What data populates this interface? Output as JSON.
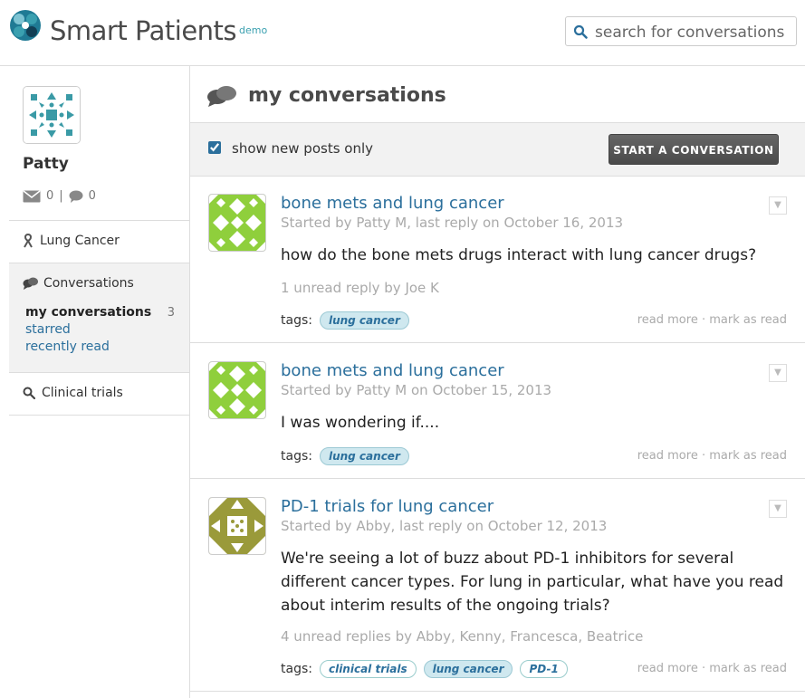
{
  "header": {
    "app_name": "Smart Patients",
    "badge": "demo",
    "search_placeholder": "search for conversations"
  },
  "sidebar": {
    "username": "Patty",
    "message_count": "0",
    "separator": "|",
    "comment_count": "0",
    "condition": "Lung Cancer",
    "conversations_label": "Conversations",
    "links": [
      {
        "label": "my conversations",
        "count": "3"
      },
      {
        "label": "starred"
      },
      {
        "label": "recently read"
      }
    ],
    "clinical_trials": "Clinical trials"
  },
  "main": {
    "title": "my conversations",
    "show_new_label": "show new posts only",
    "show_new_checked": true,
    "start_button": "START A CONVERSATION",
    "posts": [
      {
        "title": "bone mets and lung cancer",
        "meta": "Started by Patty M, last reply on October 16, 2013",
        "body": "how do the bone mets drugs interact with lung cancer drugs?",
        "replies": "1 unread reply by Joe K",
        "tags_label": "tags:",
        "tags": [
          "lung cancer"
        ],
        "links": "read more · mark as read",
        "avatar_color": "#8fcf3c"
      },
      {
        "title": "bone mets and lung cancer",
        "meta": "Started by Patty M on October 15, 2013",
        "body": "I was wondering if....",
        "tags_label": "tags:",
        "tags": [
          "lung cancer"
        ],
        "links": "read more · mark as read",
        "avatar_color": "#8fcf3c"
      },
      {
        "title": "PD-1 trials for lung cancer",
        "meta": "Started by Abby, last reply on October 12, 2013",
        "body": "We're seeing a lot of buzz about PD-1 inhibitors for several different cancer types. For lung in particular, what have you read about interim results of the ongoing trials?",
        "replies": "4 unread replies by Abby, Kenny, Francesca, Beatrice",
        "tags_label": "tags:",
        "tags": [
          "clinical trials",
          "lung cancer",
          "PD-1"
        ],
        "links": "read more · mark as read",
        "avatar_color": "#9a9a3a"
      }
    ]
  },
  "colors": {
    "accent": "#2b6f9c",
    "tag_highlight": "#cfe8ef",
    "button": "#4a4a4a"
  },
  "icons": [
    "logo-mark",
    "search-icon",
    "mail-icon",
    "comment-icon",
    "ribbon-icon",
    "conversations-icon",
    "search-icon",
    "chevron-down-icon"
  ]
}
